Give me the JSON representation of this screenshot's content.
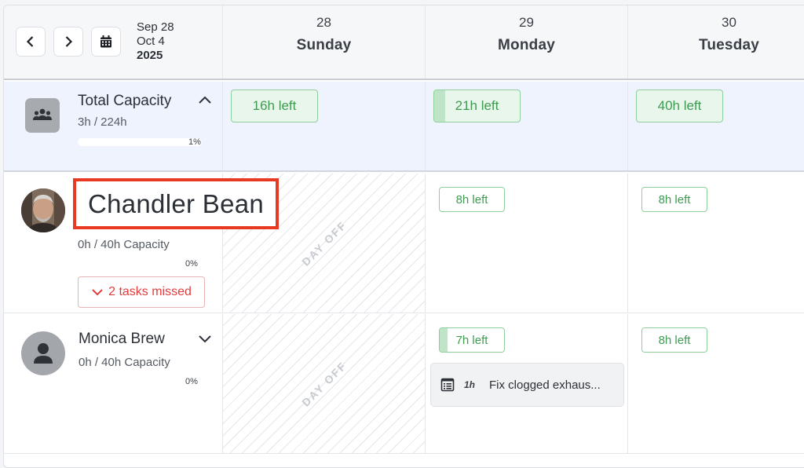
{
  "header": {
    "date_range": {
      "start": "Sep 28",
      "end": "Oct 4",
      "year": "2025"
    },
    "days": [
      {
        "num": "28",
        "name": "Sunday"
      },
      {
        "num": "29",
        "name": "Monday"
      },
      {
        "num": "30",
        "name": "Tuesday"
      }
    ]
  },
  "total": {
    "title": "Total Capacity",
    "hours": "3h / 224h",
    "percent": "1%",
    "progress": 0.01,
    "days": [
      {
        "label": "16h left",
        "used": 0
      },
      {
        "label": "21h left",
        "used": 0.13
      },
      {
        "label": "40h left",
        "used": 0
      }
    ]
  },
  "people": [
    {
      "name": "Chandler Bean",
      "capacity": "0h / 40h Capacity",
      "percent": "0%",
      "missed": "2 tasks missed",
      "dayoff": "DAY OFF",
      "days": [
        {
          "label": "8h left"
        },
        {
          "label": "8h left"
        }
      ]
    },
    {
      "name": "Monica Brew",
      "capacity": "0h / 40h Capacity",
      "percent": "0%",
      "dayoff": "DAY OFF",
      "days": [
        {
          "label": "7h left",
          "used": 0.12
        },
        {
          "label": "8h left"
        }
      ],
      "task": {
        "hours": "1h",
        "title": "Fix clogged exhaus..."
      }
    }
  ]
}
